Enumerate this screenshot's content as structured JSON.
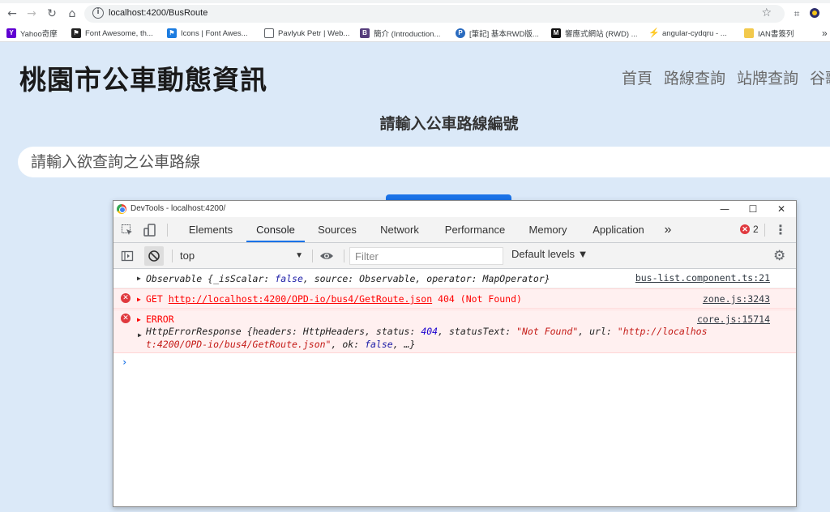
{
  "browser": {
    "url": "localhost:4200/BusRoute",
    "bookmarks": [
      {
        "label": "Yahoo奇摩",
        "icon": "Y",
        "color": "#6001d2"
      },
      {
        "label": "Font Awesome, th...",
        "icon": "flag",
        "color": "#222222"
      },
      {
        "label": "Icons | Font Awes...",
        "icon": "flag",
        "color": "#1c7ce0"
      },
      {
        "label": "Pavlyuk Petr | Web...",
        "icon": "doc",
        "color": "#5f6368"
      },
      {
        "label": "簡介 (Introduction...",
        "icon": "B",
        "color": "#563d7c"
      },
      {
        "label": "[筆記] 基本RWD版...",
        "icon": "P",
        "color": "#2a6bbf"
      },
      {
        "label": "響應式網站 (RWD) ...",
        "icon": "M",
        "color": "#111111"
      },
      {
        "label": "angular-cydqru - ...",
        "icon": "bolt",
        "color": "#1976d2"
      },
      {
        "label": "IAN書簽列",
        "icon": "folder",
        "color": "#f2c94c"
      }
    ]
  },
  "page": {
    "title": "桃園市公車動態資訊",
    "nav": [
      "首頁",
      "路線查詢",
      "站牌查詢",
      "谷歌"
    ],
    "subtitle": "請輸入公車路線編號",
    "input_placeholder": "請輸入欲查詢之公車路線"
  },
  "devtools": {
    "window_title": "DevTools - localhost:4200/",
    "tabs": [
      "Elements",
      "Console",
      "Sources",
      "Network",
      "Performance",
      "Memory",
      "Application"
    ],
    "active_tab": "Console",
    "more_tabs": "»",
    "error_count": "2",
    "context": "top",
    "filter_placeholder": "Filter",
    "levels": "Default levels ▼",
    "logs": {
      "observable": {
        "prefix": "Observable {",
        "k1": "_isScalar",
        "v1": "false",
        "k2": "source",
        "v2": "Observable",
        "k3": "operator",
        "v3": "MapOperator",
        "suffix": "}",
        "source": "bus-list.component.ts:21"
      },
      "get": {
        "method": "GET",
        "url": "http://localhost:4200/OPD-io/bus4/GetRoute.json",
        "status": "404 (Not Found)",
        "source": "zone.js:3243"
      },
      "error": {
        "label": "ERROR",
        "source": "core.js:15714",
        "line1_prefix": "HttpErrorResponse {",
        "k_headers": "headers",
        "v_headers": "HttpHeaders",
        "k_status": "status",
        "v_status": "404",
        "k_statustext": "statusText",
        "v_statustext": "\"Not Found\"",
        "k_url": "url",
        "v_url_1": "\"http://localhos",
        "v_url_2": "t:4200/OPD-io/bus4/GetRoute.json\"",
        "k_ok": "ok",
        "v_ok": "false",
        "tail": ", …}"
      }
    }
  }
}
